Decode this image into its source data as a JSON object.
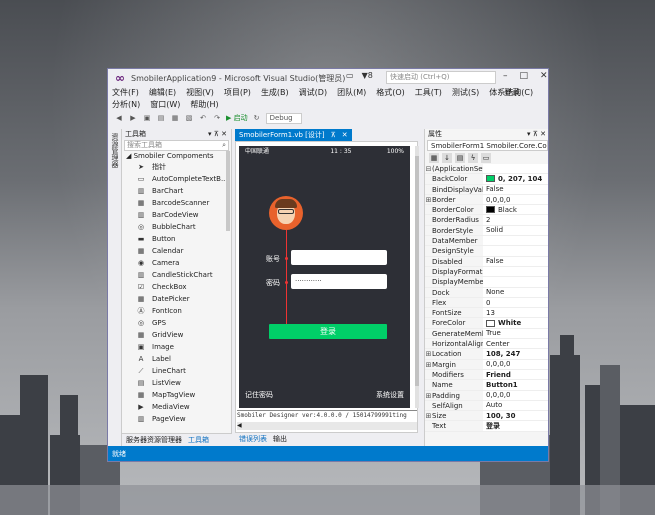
{
  "window": {
    "title": "SmobilerApplication9 - Microsoft Visual Studio(管理员)",
    "notif_count": "8",
    "quick_launch_placeholder": "快速启动 (Ctrl+Q)",
    "login": "登录"
  },
  "menu": {
    "row1": [
      "文件(F)",
      "编辑(E)",
      "视图(V)",
      "项目(P)",
      "生成(B)",
      "调试(D)",
      "团队(M)",
      "格式(O)",
      "工具(T)",
      "测试(S)",
      "体系结构(C)"
    ],
    "row2": [
      "分析(N)",
      "窗口(W)",
      "帮助(H)"
    ]
  },
  "toolbar": {
    "start": "启动",
    "config": "Debug"
  },
  "leftstrip": {
    "label": "资源管理器"
  },
  "toolbox": {
    "title": "工具箱",
    "search_placeholder": "搜索工具箱",
    "category": "Smobiler Compoments",
    "items": [
      "指针",
      "AutoCompleteTextB...",
      "BarChart",
      "BarcodeScanner",
      "BarCodeView",
      "BubbleChart",
      "Button",
      "Calendar",
      "Camera",
      "CandleStickChart",
      "CheckBox",
      "DatePicker",
      "FontIcon",
      "GPS",
      "GridView",
      "Image",
      "Label",
      "LineChart",
      "ListView",
      "MapTagView",
      "MediaView",
      "PageView"
    ],
    "tabs": [
      "服务器资源管理器",
      "工具箱"
    ]
  },
  "doc_tab": {
    "label": "SmobilerForm1.vb [设计]"
  },
  "phone": {
    "carrier": "中国联通",
    "time": "11 : 35",
    "battery": "100%",
    "account_label": "账号",
    "password_label": "密码",
    "password_value": "············",
    "login_button": "登录",
    "remember": "记住密码",
    "settings": "系统设置"
  },
  "designer": {
    "version": "Smobiler Designer ver:4.0.0.0 / 15014799991ting"
  },
  "bottom_tabs": [
    "错误列表",
    "输出"
  ],
  "properties": {
    "title": "属性",
    "object": "SmobilerForm1 Smobiler.Core.Co",
    "rows": [
      {
        "exp": "⊟",
        "name": "(ApplicationSet",
        "value": ""
      },
      {
        "exp": "",
        "name": "BackColor",
        "value": "0, 207, 104",
        "swatch": "#00cf68",
        "bold": true
      },
      {
        "exp": "",
        "name": "BindDisplayVal",
        "value": "False"
      },
      {
        "exp": "⊞",
        "name": "Border",
        "value": "0,0,0,0"
      },
      {
        "exp": "",
        "name": "BorderColor",
        "value": "Black",
        "swatch": "#000000"
      },
      {
        "exp": "",
        "name": "BorderRadius",
        "value": "2"
      },
      {
        "exp": "",
        "name": "BorderStyle",
        "value": "Solid"
      },
      {
        "exp": "",
        "name": "DataMember",
        "value": ""
      },
      {
        "exp": "",
        "name": "DesignStyle",
        "value": ""
      },
      {
        "exp": "",
        "name": "Disabled",
        "value": "False"
      },
      {
        "exp": "",
        "name": "DisplayFormat",
        "value": ""
      },
      {
        "exp": "",
        "name": "DisplayMembe",
        "value": ""
      },
      {
        "exp": "",
        "name": "Dock",
        "value": "None"
      },
      {
        "exp": "",
        "name": "Flex",
        "value": "0"
      },
      {
        "exp": "",
        "name": "FontSize",
        "value": "13"
      },
      {
        "exp": "",
        "name": "ForeColor",
        "value": "White",
        "swatch": "#ffffff",
        "bold": true
      },
      {
        "exp": "",
        "name": "GenerateMemb",
        "value": "True"
      },
      {
        "exp": "",
        "name": "HorizontalAlign",
        "value": "Center"
      },
      {
        "exp": "⊞",
        "name": "Location",
        "value": "108, 247",
        "bold": true
      },
      {
        "exp": "⊞",
        "name": "Margin",
        "value": "0,0,0,0"
      },
      {
        "exp": "",
        "name": "Modifiers",
        "value": "Friend",
        "bold": true
      },
      {
        "exp": "",
        "name": "Name",
        "value": "Button1",
        "bold": true
      },
      {
        "exp": "⊞",
        "name": "Padding",
        "value": "0,0,0,0"
      },
      {
        "exp": "",
        "name": "SelfAlign",
        "value": "Auto"
      },
      {
        "exp": "⊞",
        "name": "Size",
        "value": "100, 30",
        "bold": true
      },
      {
        "exp": "",
        "name": "Text",
        "value": "登录",
        "bold": true
      }
    ]
  },
  "statusbar": {
    "text": "就绪"
  }
}
